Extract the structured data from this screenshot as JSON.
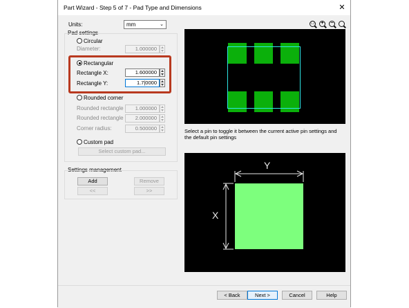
{
  "window": {
    "title": "Part Wizard - Step 5 of 7 - Pad Type and Dimensions",
    "close_glyph": "✕"
  },
  "units": {
    "label": "Units:",
    "value": "mm"
  },
  "pad_settings": {
    "title": "Pad settings",
    "circular": {
      "label": "Circular",
      "diameter_label": "Diameter:",
      "diameter_value": "1.000000"
    },
    "rectangular": {
      "label": "Rectangular",
      "x_label": "Rectangle X:",
      "x_value": "1.600000",
      "y_label": "Rectangle Y:",
      "y_value": "1.7|0000"
    },
    "rounded": {
      "label": "Rounded corner",
      "x_label": "Rounded rectangle X:",
      "x_value": "1.000000",
      "y_label": "Rounded rectangle Y:",
      "y_value": "2.000000",
      "radius_label": "Corner radius:",
      "radius_value": "0.500000"
    },
    "custom": {
      "label": "Custom pad",
      "button": "Select custom pad..."
    }
  },
  "settings_management": {
    "title": "Settings management",
    "add": "Add",
    "remove": "Remove",
    "prev": "<<",
    "next": ">>"
  },
  "zoom_icons": [
    "zoom-fit-icon",
    "zoom-in-icon",
    "zoom-out-icon",
    "zoom-icon"
  ],
  "preview": {
    "hint": "Select a pin to toggle it between the current active pin settings and the default pin settings",
    "pad_y_label": "Y",
    "pad_x_label": "X"
  },
  "buttons": {
    "back": "< Back",
    "next": "Next >",
    "cancel": "Cancel",
    "help": "Help"
  },
  "colors": {
    "pin": "#0bb00b",
    "outline": "#2ee6e6",
    "pad": "#7dff7d",
    "highlight": "#b8391f"
  }
}
